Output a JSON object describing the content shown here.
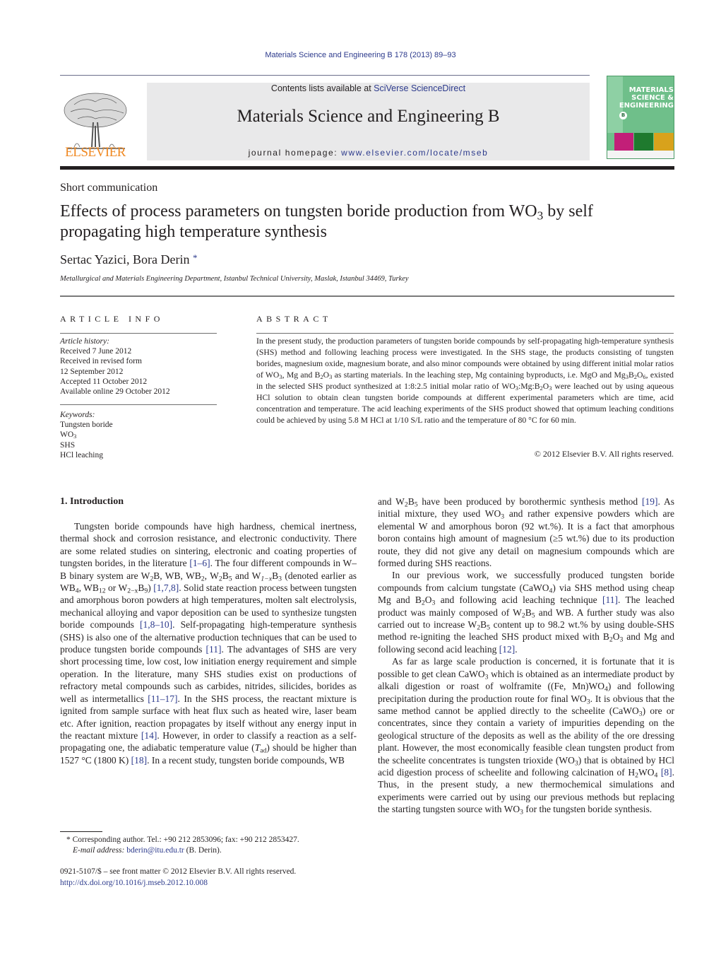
{
  "header": {
    "citation": "Materials Science and Engineering B 178 (2013) 89–93",
    "contents_prefix": "Contents lists available at ",
    "contents_link": "SciVerse ScienceDirect",
    "journal_title": "Materials Science and Engineering B",
    "homepage_prefix": "journal homepage: ",
    "homepage_link": "www.elsevier.com/locate/mseb",
    "publisher_logo": "ELSEVIER",
    "publisher_logo_color": "#f08a24",
    "cover": {
      "title_line1": "MATERIALS",
      "title_line2": "SCIENCE &",
      "title_line3": "ENGINEERING",
      "series_letter": "B",
      "accent_color": "#6fbf8a"
    }
  },
  "article": {
    "type": "Short communication",
    "title_part1": "Effects of process parameters on tungsten boride production from WO",
    "title_sub": "3",
    "title_part2": " by self propagating high temperature synthesis",
    "authors": "Sertac Yazici, Bora Derin",
    "author_marker": "*",
    "affiliation": "Metallurgical and Materials Engineering Department, Istanbul Technical University, Maslak, Istanbul 34469, Turkey"
  },
  "article_info": {
    "heading": "ARTICLE INFO",
    "history_label": "Article history:",
    "history": [
      "Received 7 June 2012",
      "Received in revised form",
      "12 September 2012",
      "Accepted 11 October 2012",
      "Available online 29 October 2012"
    ],
    "keywords_label": "Keywords:",
    "keywords": [
      "Tungsten boride",
      "WO",
      "SHS",
      "HCl leaching"
    ],
    "keyword_wo_sub": "3"
  },
  "abstract": {
    "heading": "ABSTRACT",
    "s1": "In the present study, the production parameters of tungsten boride compounds by self-propagating high-temperature synthesis (SHS) method and following leaching process were investigated. In the SHS stage, the products consisting of tungsten borides, magnesium oxide, magnesium borate, and also minor compounds were obtained by using different initial molar ratios of WO",
    "s2": ", Mg and B",
    "s3": "O",
    "s4": " as starting materials. In the leaching step, Mg containing byproducts, i.e. MgO and Mg",
    "s5": "B",
    "s6": "O",
    "s7": ", existed in the selected SHS product synthesized at 1:8:2.5 initial molar ratio of WO",
    "s8": ":Mg:B",
    "s9": "O",
    "s10": " were leached out by using aqueous HCl solution to obtain clean tungsten boride compounds at different experimental parameters which are time, acid concentration and temperature. The acid leaching experiments of the SHS product showed that optimum leaching conditions could be achieved by using 5.8 M HCl at 1/10 S/L ratio and the temperature of 80 °C for 60 min.",
    "sub_3": "3",
    "sub_2": "2",
    "sub_6": "6",
    "copyright": "© 2012 Elsevier B.V. All rights reserved."
  },
  "intro": {
    "heading": "1.  Introduction",
    "left": {
      "a1": "Tungsten boride compounds have high hardness, chemical inertness, thermal shock and corrosion resistance, and electronic conductivity. There are some related studies on sintering, electronic and coating properties of tungsten borides, in the literature ",
      "ref1": "[1–6]",
      "a2": ". The four different compounds in W–B binary system are W",
      "a3": "B, WB, WB",
      "a4": ", W",
      "a5": "B",
      "a6": " and W",
      "a7": "B",
      "a8": " (denoted earlier as WB",
      "a9": ", WB",
      "a10": " or W",
      "a11": "B",
      "a12": ") ",
      "ref2": "[1,7,8]",
      "a13": ". Solid state reaction process between tungsten and amorphous boron powders at high temperatures, molten salt electrolysis, mechanical alloying and vapor deposition can be used to synthesize tungsten boride compounds ",
      "ref3": "[1,8–10]",
      "a14": ". Self-propagating high-temperature synthesis (SHS) is also one of the alternative production techniques that can be used to produce tungsten boride compounds ",
      "ref4": "[11]",
      "a15": ". The advantages of SHS are very short processing time, low cost, low initiation energy requirement and simple operation. In the literature, many SHS studies exist on productions of refractory metal compounds such as carbides, nitrides, silicides, borides as well as intermetallics ",
      "ref5": "[11–17]",
      "a16": ". In the SHS process, the reactant mixture is ignited from sample surface with heat flux such as heated wire, laser beam etc. After ignition, reaction propagates by itself without any energy input in the reactant mixture ",
      "ref6": "[14]",
      "a17": ". However, in order to classify a reaction as a self-propagating one, the adiabatic temperature value (",
      "tad_T": "T",
      "tad_sub": "ad",
      "a18": ") should be higher than 1527 °C (1800 K) ",
      "ref7": "[18]",
      "a19": ". In a recent study, tungsten boride compounds, WB",
      "s2": "2",
      "s5": "5",
      "s1x": "1−x",
      "s3": "3",
      "s4": "4",
      "s12": "12",
      "s2x": "2−x",
      "s9": "9"
    },
    "right": {
      "p1a": "and W",
      "p1b": "B",
      "p1c": " have been produced by borothermic synthesis method ",
      "ref19": "[19]",
      "p1d": ". As initial mixture, they used WO",
      "p1e": " and rather expensive powders which are elemental W and amorphous boron (92 wt.%). It is a fact that amorphous boron contains high amount of magnesium (≥5 wt.%) due to its production route, they did not give any detail on magnesium compounds which are formed during SHS reactions.",
      "p2a": "In our previous work, we successfully produced tungsten boride compounds from calcium tungstate (CaWO",
      "p2b": ") via SHS method using cheap Mg and B",
      "p2c": "O",
      "p2d": " and following acid leaching technique ",
      "ref11": "[11]",
      "p2e": ". The leached product was mainly composed of W",
      "p2f": "B",
      "p2g": " and WB. A further study was also carried out to increase W",
      "p2h": "B",
      "p2i": " content up to 98.2 wt.% by using double-SHS method re-igniting the leached SHS product mixed with B",
      "p2j": "O",
      "p2k": " and Mg and following second acid leaching ",
      "ref12": "[12]",
      "p2l": ".",
      "p3a": "As far as large scale production is concerned, it is fortunate that it is possible to get clean CaWO",
      "p3b": " which is obtained as an intermediate product by alkali digestion or roast of wolframite ((Fe, Mn)WO",
      "p3c": ") and following precipitation during the production route for final WO",
      "p3d": ". It is obvious that the same method cannot be applied directly to the scheelite (CaWO",
      "p3e": ") ore or concentrates, since they contain a variety of impurities depending on the geological structure of the deposits as well as the ability of the ore dressing plant. However, the most economically feasible clean tungsten product from the scheelite concentrates is tungsten trioxide (WO",
      "p3f": ") that is obtained by HCl acid digestion process of scheelite and following calcination of H",
      "p3g": "WO",
      "p3h": " ",
      "ref8": "[8]",
      "p3i": ". Thus, in the present study, a new thermochemical simulations and experiments were carried out by using our previous methods but replacing the starting tungsten source with WO",
      "p3j": " for the tungsten boride synthesis.",
      "s2": "2",
      "s3": "3",
      "s4": "4",
      "s5": "5"
    }
  },
  "footnote": {
    "marker": "*",
    "text": "Corresponding author. Tel.: +90 212 2853096; fax: +90 212 2853427.",
    "email_label": "E-mail address:",
    "email": "bderin@itu.edu.tr",
    "email_suffix": " (B. Derin).",
    "front_matter": "0921-5107/$ – see front matter © 2012 Elsevier B.V. All rights reserved.",
    "doi": "http://dx.doi.org/10.1016/j.mseb.2012.10.008"
  }
}
